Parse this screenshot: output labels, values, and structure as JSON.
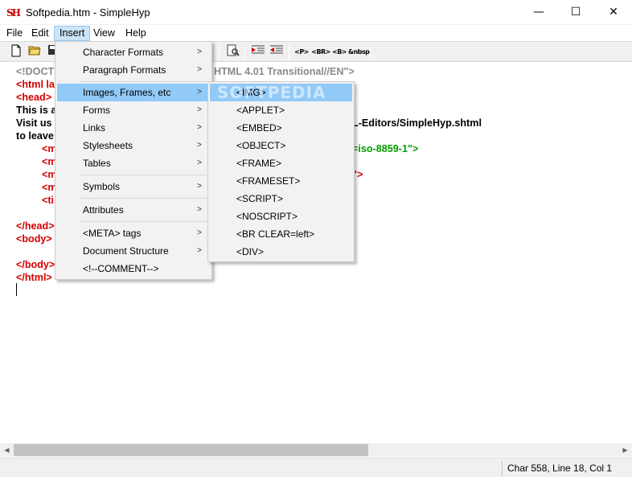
{
  "window": {
    "title": "Softpedia.htm - SimpleHyp",
    "app_icon_text": "SH",
    "min_glyph": "—",
    "max_glyph": "☐",
    "close_glyph": "✕"
  },
  "menubar": [
    "File",
    "Edit",
    "Insert",
    "View",
    "Help"
  ],
  "toolbar": {
    "tag_buttons": [
      "<P>",
      "<BR>",
      "<B>",
      "&nbsp"
    ]
  },
  "editor": {
    "lines": [
      {
        "parts": [
          {
            "t": "<!DOCT",
            "c": "gray"
          },
          {
            "t": "HTML 4.01 Transitional//EN\">",
            "c": "gray"
          }
        ]
      },
      {
        "parts": [
          {
            "t": "<html la",
            "c": "red"
          }
        ]
      },
      {
        "parts": [
          {
            "t": "<head>",
            "c": "red"
          }
        ]
      },
      {
        "parts": [
          {
            "t": "This is a",
            "c": "black"
          }
        ]
      },
      {
        "parts": [
          {
            "t": "Visit us",
            "c": "black"
          },
          {
            "t": "L-Editors/SimpleHyp.shtml",
            "c": "black"
          }
        ]
      },
      {
        "parts": [
          {
            "t": "to leave",
            "c": "black"
          }
        ]
      },
      {
        "parts": [
          {
            "t": "<m",
            "c": "red"
          },
          {
            "t": "=iso-8859-1\">",
            "c": "green"
          }
        ]
      },
      {
        "parts": [
          {
            "t": "<m",
            "c": "red"
          }
        ]
      },
      {
        "parts": [
          {
            "t": "<m",
            "c": "red"
          },
          {
            "t": "\">",
            "c": "red"
          }
        ]
      },
      {
        "parts": [
          {
            "t": "<m",
            "c": "red"
          }
        ]
      },
      {
        "parts": [
          {
            "t": "<ti",
            "c": "red"
          }
        ]
      },
      {
        "parts": []
      },
      {
        "parts": [
          {
            "t": "</head>",
            "c": "red"
          }
        ]
      },
      {
        "parts": [
          {
            "t": "<body>",
            "c": "red"
          }
        ]
      },
      {
        "parts": []
      },
      {
        "parts": [
          {
            "t": "</body>",
            "c": "red"
          }
        ]
      },
      {
        "parts": [
          {
            "t": "</html>",
            "c": "red"
          }
        ]
      }
    ]
  },
  "insert_menu": {
    "items": [
      "Character Formats",
      "Paragraph Formats",
      "Images, Frames, etc",
      "Forms",
      "Links",
      "Stylesheets",
      "Tables",
      "Symbols",
      "Attributes",
      "<META> tags",
      "Document Structure",
      "<!--COMMENT-->"
    ],
    "highlighted": "Images, Frames, etc"
  },
  "submenu": {
    "items": [
      "<IMG>",
      "<APPLET>",
      "<EMBED>",
      "<OBJECT>",
      "<FRAME>",
      "<FRAMESET>",
      "<SCRIPT>",
      "<NOSCRIPT>",
      "<BR CLEAR=left>",
      "<DIV>"
    ],
    "highlighted": "<IMG>"
  },
  "statusbar": {
    "position": "Char 558, Line 18, Col 1"
  },
  "watermark": "SOFTPEDIA",
  "colors": {
    "tag": "#d40000",
    "doctype": "#8a8a8a",
    "attr_value": "#00a000",
    "menu_highlight": "#91c9f7"
  }
}
